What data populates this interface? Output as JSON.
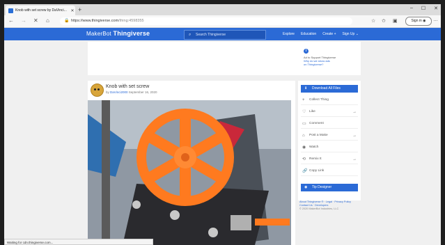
{
  "browser": {
    "tab_title": "Knob with set screw by DaVinci...",
    "url_host": "https://www.thingiverse.com",
    "url_path": "/thing:4598355",
    "signin_label": "Sign in",
    "status_text": "Waiting for cdn.thingiverse.com..."
  },
  "site": {
    "logo_brand": "MakerBot",
    "logo_name": "Thingiverse",
    "search_placeholder": "Search Thingiverse",
    "nav": [
      "Explore",
      "Education",
      "Create",
      "Sign Up"
    ]
  },
  "ad": {
    "line1": "Ad to Support Thingiverse",
    "line2": "Why do we show ads",
    "line3": "on Thingiverse?"
  },
  "thing": {
    "title": "Knob with set screw",
    "by": "by",
    "author": "DaVinci2000",
    "date": "September 16, 2020"
  },
  "sidebar": {
    "download_label": "Download All Files",
    "actions": [
      {
        "icon": "plus-icon",
        "label": "Collect Thing",
        "arrow": false
      },
      {
        "icon": "heart-icon",
        "label": "Like",
        "arrow": true
      },
      {
        "icon": "comment-icon",
        "label": "Comment",
        "arrow": false
      },
      {
        "icon": "makes-icon",
        "label": "Post a Make",
        "arrow": true
      },
      {
        "icon": "eye-icon",
        "label": "Watch",
        "arrow": false
      },
      {
        "icon": "remix-icon",
        "label": "Remix It",
        "arrow": true
      },
      {
        "icon": "link-icon",
        "label": "Copy Link",
        "arrow": false
      }
    ],
    "tip_label": "Tip Designer"
  },
  "footer": {
    "line1": "About Thingiverse ® · Legal · Privacy Policy",
    "line2": "Contact Us · Developers",
    "line3": "© 2020 MakerBot Industries, LLC"
  },
  "colors": {
    "brand_blue": "#2b6ad6",
    "knob_orange": "#ff7a1f"
  }
}
